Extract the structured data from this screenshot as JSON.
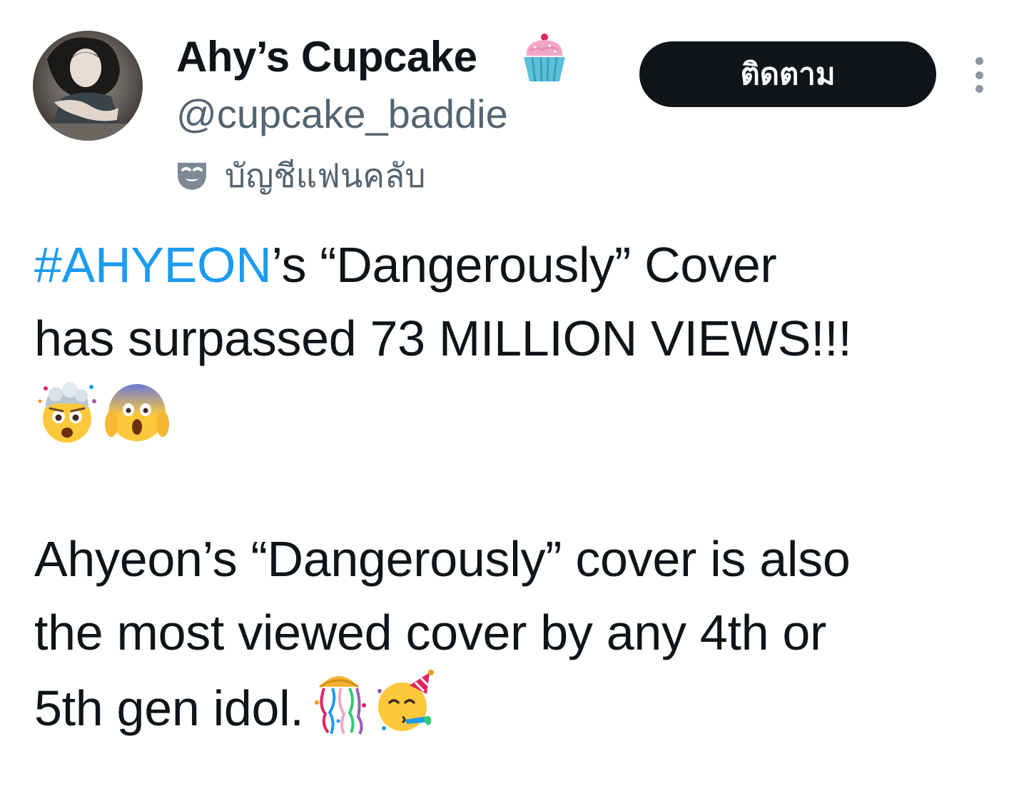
{
  "author": {
    "display_name": "Ahy’s Cupcake",
    "display_name_emoji": "cupcake-icon",
    "handle": "@cupcake_baddie",
    "fan_account_icon": "theater-mask-icon",
    "fan_account_label": "บัญชีแฟนคลับ"
  },
  "actions": {
    "follow_label": "ติดตาม",
    "more_icon": "more-vertical-icon"
  },
  "tweet": {
    "hashtag": "#AHYEON",
    "line1_rest": "’s “Dangerously” Cover",
    "line2": "has surpassed 73 MILLION VIEWS!!!",
    "line3_emojis": [
      "exploding-head-icon",
      "screaming-face-icon"
    ],
    "line5": "Ahyeon’s “Dangerously” cover is also",
    "line6": "the most viewed cover by any 4th or",
    "line7": "5th gen idol.",
    "line7_emojis": [
      "confetti-ball-icon",
      "partying-face-icon"
    ]
  },
  "colors": {
    "text": "#0f1419",
    "secondary": "#536471",
    "link": "#1d9bf0",
    "button_bg": "#0f1419",
    "button_text": "#ffffff"
  }
}
